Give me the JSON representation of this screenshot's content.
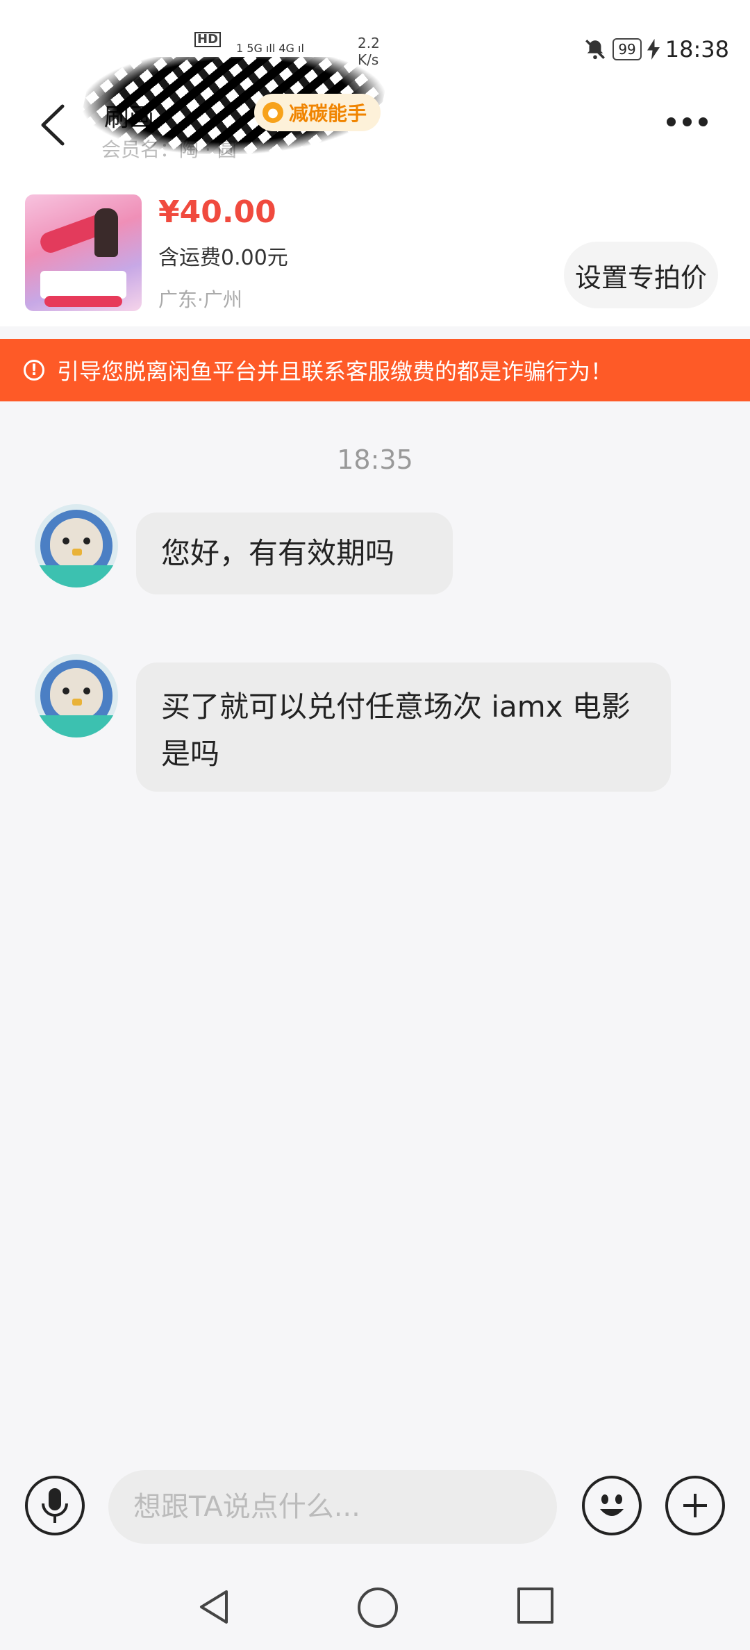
{
  "status_bar": {
    "left_hd": "HD",
    "left_signal": "1 5G ıll 4G ıl",
    "speed_value": "2.2",
    "speed_unit": "K/s",
    "battery": "99",
    "time": "18:38"
  },
  "header": {
    "seller_name": "刷画",
    "member_label": "会员名：陶 · 圆",
    "badge_label": "减碳能手",
    "icons": {
      "back": "chevron-left-icon",
      "more": "more-dots-icon",
      "badge": "leaf-icon"
    }
  },
  "product": {
    "price": "¥40.00",
    "shipping": "含运费0.00元",
    "location": "广东·广州",
    "special_price_button": "设置专拍价"
  },
  "warning": {
    "text": "引导您脱离闲鱼平台并且联系客服缴费的都是诈骗行为！",
    "icon": "exclamation-circle-icon",
    "color": "#fe5a27"
  },
  "chat": {
    "timestamp": "18:35",
    "messages": [
      {
        "text": "您好，有有效期吗"
      },
      {
        "text": "买了就可以兑付任意场次 iamx 电影是吗"
      }
    ]
  },
  "input_bar": {
    "placeholder": "想跟TA说点什么...",
    "value": "",
    "icons": {
      "voice": "microphone-icon",
      "emoji": "smiley-icon",
      "more": "plus-icon"
    }
  },
  "navigation": {
    "icons": [
      "triangle-back-icon",
      "circle-home-icon",
      "square-recent-icon"
    ]
  },
  "colors": {
    "price": "#f04a3e",
    "badge_bg": "#fdf1d9",
    "badge_text": "#f08400"
  }
}
